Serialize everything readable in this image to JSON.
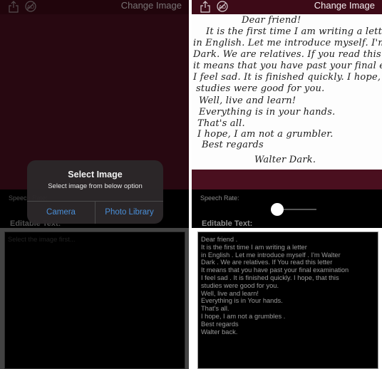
{
  "navbar": {
    "share_icon": "share-icon",
    "noads_icon": "no-ads-icon",
    "change_image_label": "Change Image"
  },
  "colors": {
    "navbar_bg": "#3d0a17",
    "image_area_bg": "#4a0f1f",
    "alert_button_text": "#4a8fd8"
  },
  "left_screen": {
    "speech_rate_label": "Speech Rate:",
    "editable_label": "Editable Text:",
    "text_placeholder": "Select the image first...",
    "alert": {
      "title": "Select Image",
      "message": "Select image from below option",
      "buttons": [
        "Camera",
        "Photo Library"
      ]
    }
  },
  "right_screen": {
    "speech_rate_label": "Speech Rate:",
    "speech_rate_value": 0.0,
    "editable_label": "Editable Text:",
    "letter_image_lines": [
      "Dear friend!",
      "It is the first time I am writing a letter",
      "in English. Let me introduce myself. I'm Walter",
      "Dark. We are relatives. If you read this letter",
      "it means that you have past your final examination",
      "I feel sad. It is finished quickly. I hope, that this",
      "studies were good for you.",
      "Well, live and learn!",
      "Everything is in your hands.",
      "That's all.",
      "I hope, I am not a grumbler.",
      "Best regards",
      "Walter Dark."
    ],
    "editable_text_lines": [
      "Dear friend .",
      "It is the first time I am writing a letter",
      "in English . Let me introduce myself . I'm Walter",
      "Dark . We are relatives. If You read this letter",
      "It means that you have past your final examination",
      "I feel sad . It is finished quickly. I hope, that this",
      "studies were good for you.",
      "Well, live and learn!",
      "Everything is in Your hands.",
      "That's all.",
      "I hope, I am not a grumbles .",
      "Best regards",
      "Walter back."
    ]
  }
}
